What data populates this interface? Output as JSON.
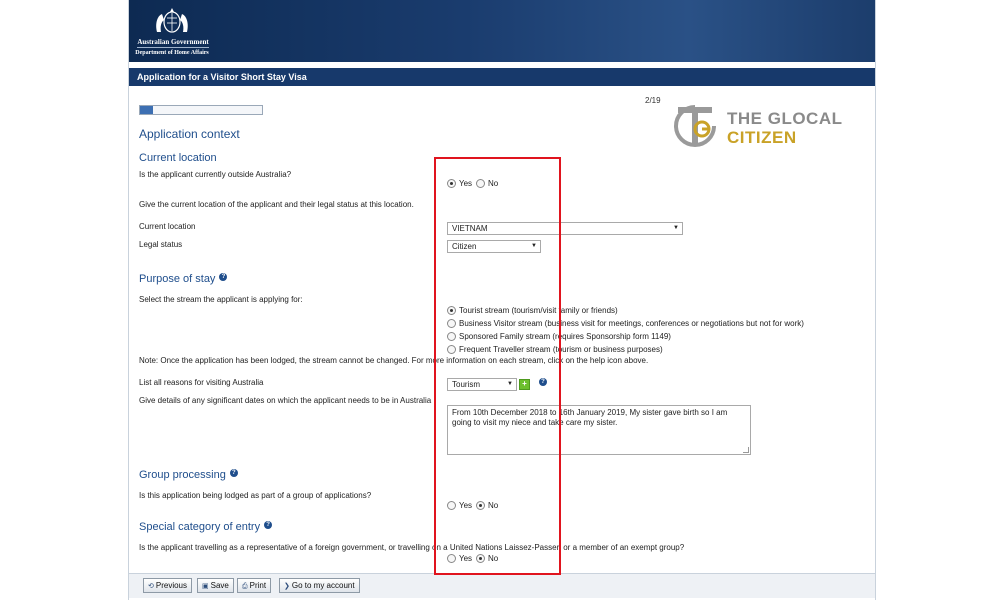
{
  "header": {
    "gov_name": "Australian Government",
    "department": "Department of Home Affairs",
    "form_title": "Application for a Visitor Short Stay Visa"
  },
  "progress": {
    "page_label": "2/19",
    "current_page": 2,
    "total_pages": 19
  },
  "page_title": "Application context",
  "current_location": {
    "heading": "Current location",
    "q_outside": "Is the applicant currently outside Australia?",
    "outside_options": [
      "Yes",
      "No"
    ],
    "outside_selected": "Yes",
    "q_give_location": "Give the current location of the applicant and their legal status at this location.",
    "location_label": "Current location",
    "location_value": "VIETNAM",
    "status_label": "Legal status",
    "status_value": "Citizen"
  },
  "purpose": {
    "heading": "Purpose of stay",
    "q_stream": "Select the stream the applicant is applying for:",
    "streams": [
      "Tourist stream (tourism/visit family or friends)",
      "Business Visitor stream (business visit for meetings, conferences or negotiations but not for work)",
      "Sponsored Family stream (requires Sponsorship form 1149)",
      "Frequent Traveller stream (tourism or business purposes)"
    ],
    "stream_selected_index": 0,
    "note": "Note: Once the application has been lodged, the stream cannot be changed. For more information on each stream, click on the help icon above.",
    "reasons_label": "List all reasons for visiting Australia",
    "reasons_value": "Tourism",
    "dates_label": "Give details of any significant dates on which the applicant needs to be in Australia",
    "dates_value": "From 10th December 2018 to 16th January 2019, My sister gave birth so I am going to visit my niece and take care my sister."
  },
  "group": {
    "heading": "Group processing",
    "q": "Is this application being lodged as part of a group of applications?",
    "options": [
      "Yes",
      "No"
    ],
    "selected": "No"
  },
  "special": {
    "heading": "Special category of entry",
    "q": "Is the applicant travelling as a representative of a foreign government, or travelling on a United Nations Laissez-Passer, or a member of an exempt group?",
    "options": [
      "Yes",
      "No"
    ],
    "selected": "No"
  },
  "toolbar": {
    "previous": "Previous",
    "save": "Save",
    "print": "Print",
    "account": "Go to my account"
  },
  "watermark": {
    "line1": "THE GLOCAL",
    "line2": "CITIZEN"
  },
  "colors": {
    "header": "#17396b",
    "heading": "#1f4e8c",
    "highlight_box": "#e0141e",
    "brand_gold": "#c9a227"
  }
}
